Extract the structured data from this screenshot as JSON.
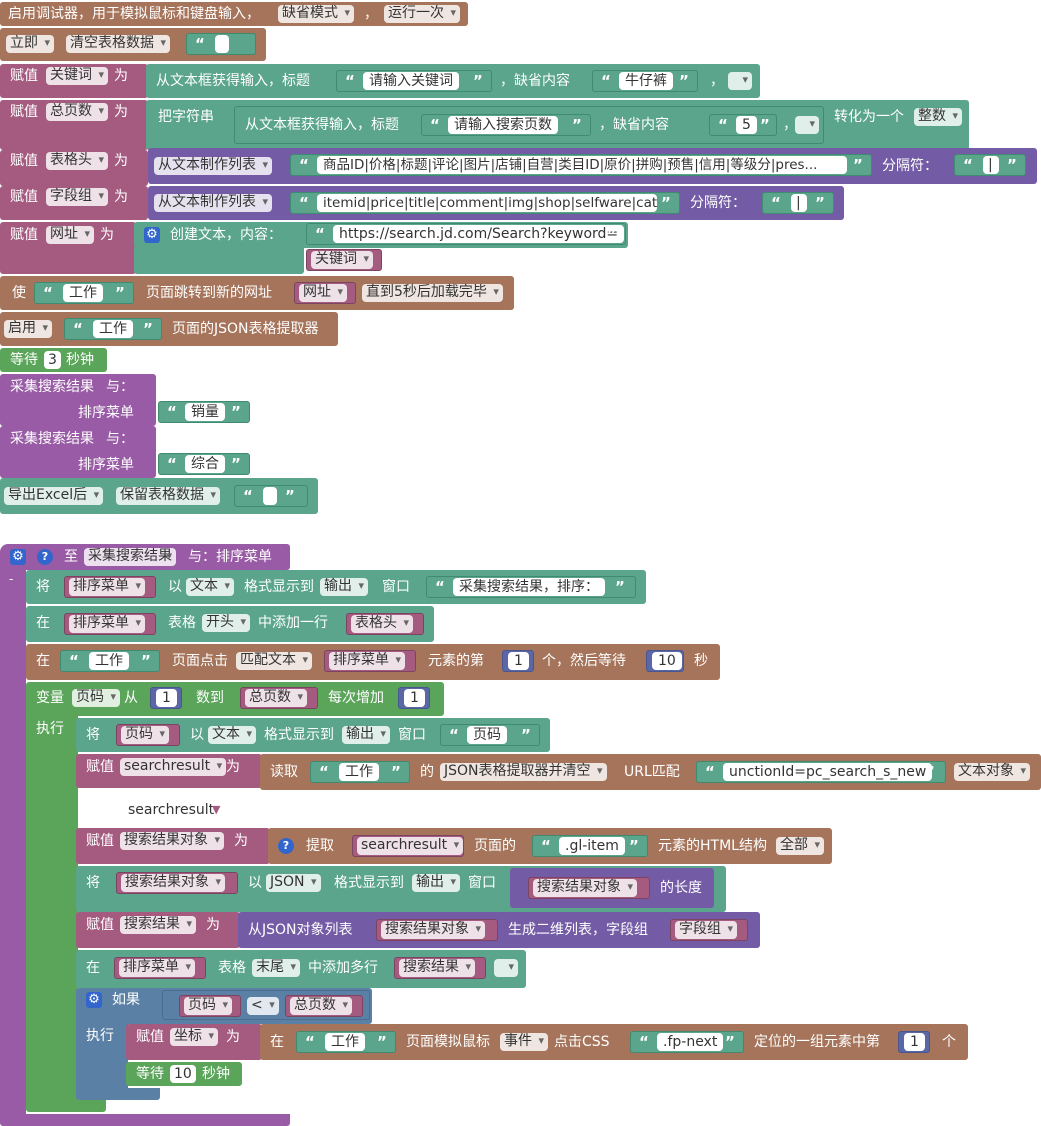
{
  "row1": {
    "text": "启用调试器，用于模拟鼠标和键盘输入，",
    "dd1": "缺省模式",
    "sep": "，",
    "dd2": "运行一次"
  },
  "row2": {
    "dd1": "立即",
    "dd2": "清空表格数据"
  },
  "row3": {
    "assign": "赋值",
    "var": "关键词",
    "as": "为",
    "text": "从文本框获得输入，标题",
    "title": "请输入关键词",
    "default_label": "，缺省内容",
    "default": "牛仔裤",
    "sep": "，"
  },
  "row4": {
    "assign": "赋值",
    "var": "总页数",
    "as": "为",
    "prefix": "把字符串",
    "text": "从文本框获得输入，标题",
    "title": "请输入搜索页数",
    "default_label": "，缺省内容",
    "default": "5",
    "sep": "，",
    "convert": "转化为一个",
    "type": "整数"
  },
  "row5": {
    "assign": "赋值",
    "var": "表格头",
    "as": "为",
    "fn": "从文本制作列表",
    "value": "商品ID|价格|标题|评论|图片|店铺|自营|类目ID|原价|拼购|预售|信用|等级分|pres...",
    "sep_label": "分隔符：",
    "sep": "|"
  },
  "row6": {
    "assign": "赋值",
    "var": "字段组",
    "as": "为",
    "fn": "从文本制作列表",
    "value": "itemid|price|title|comment|img|shop|selfware|cat...",
    "sep_label": "分隔符：",
    "sep": "|"
  },
  "row7": {
    "assign": "赋值",
    "var": "网址",
    "as": "为",
    "text": "创建文本，内容：",
    "url": "https://search.jd.com/Search?keyword=",
    "var2": "关键词"
  },
  "row8": {
    "use": "使",
    "tab": "工作",
    "text": "页面跳转到新的网址",
    "var": "网址",
    "wait": "直到5秒后加载完毕"
  },
  "row9": {
    "dd": "启用",
    "tab": "工作",
    "text": "页面的JSON表格提取器"
  },
  "row10": {
    "wait": "等待",
    "num": "3",
    "unit": "秒钟"
  },
  "call1": {
    "name": "采集搜索结果",
    "with": "与：",
    "param": "排序菜单",
    "value": "销量"
  },
  "call2": {
    "name": "采集搜索结果",
    "with": "与：",
    "param": "排序菜单",
    "value": "综合"
  },
  "row13": {
    "dd1": "导出Excel后",
    "dd2": "保留表格数据"
  },
  "fn": {
    "to": "至",
    "name": "采集搜索结果",
    "with": "与：排序菜单",
    "collapse": "-",
    "l1": {
      "do": "将",
      "var": "排序菜单",
      "as": "以",
      "fmt": "文本",
      "fmt_label": "格式显示到",
      "out": "输出",
      "win": "窗口",
      "text": "采集搜索结果，排序："
    },
    "l2": {
      "in": "在",
      "var": "排序菜单",
      "tbl": "表格",
      "pos": "开头",
      "add": "中添加一行",
      "var2": "表格头"
    },
    "l3": {
      "in": "在",
      "tab": "工作",
      "click": "页面点击",
      "mode": "匹配文本",
      "var": "排序菜单",
      "nth": "元素的第",
      "n": "1",
      "then": "个，然后等待",
      "secs": "10",
      "unit": "秒"
    },
    "loop": {
      "var_label": "变量",
      "var": "页码",
      "from": "从",
      "start": "1",
      "to": "数到",
      "end_var": "总页数",
      "step_label": "每次增加",
      "step": "1",
      "do": "执行"
    },
    "l4": {
      "do": "将",
      "var": "页码",
      "as": "以",
      "fmt": "文本",
      "fmt_label": "格式显示到",
      "out": "输出",
      "win": "窗口",
      "text": "页码"
    },
    "l5": {
      "assign": "赋值",
      "var": "searchresult",
      "as": "为",
      "read": "读取",
      "tab": "工作",
      "of": "的",
      "extractor": "JSON表格提取器并清空",
      "url": "URL匹配",
      "match": "unctionId=pc_search_s_new",
      "obj": "文本对象",
      "hint": "searchresult"
    },
    "l6": {
      "assign": "赋值",
      "var": "搜索结果对象",
      "as": "为",
      "extract": "提取",
      "var2": "searchresult",
      "page": "页面的",
      "sel": ".gl-item",
      "html": "元素的HTML结构",
      "all": "全部"
    },
    "l7": {
      "do": "将",
      "var": "搜索结果对象",
      "as": "以",
      "fmt": "JSON",
      "fmt_label": "格式显示到",
      "out": "输出",
      "win": "窗口",
      "var2": "搜索结果对象",
      "len": "的长度"
    },
    "l8": {
      "assign": "赋值",
      "var": "搜索结果",
      "as": "为",
      "fn": "从JSON对象列表",
      "var2": "搜索结果对象",
      "gen": "生成二维列表，字段组",
      "var3": "字段组"
    },
    "l9": {
      "in": "在",
      "var": "排序菜单",
      "tbl": "表格",
      "pos": "末尾",
      "add": "中添加多行",
      "var2": "搜索结果"
    },
    "if": {
      "if": "如果",
      "a": "页码",
      "op": "<",
      "b": "总页数",
      "do": "执行"
    },
    "l10": {
      "assign": "赋值",
      "var": "坐标",
      "as": "为",
      "in": "在",
      "tab": "工作",
      "mouse": "页面模拟鼠标",
      "evt": "事件",
      "click": "点击CSS",
      "sel": ".fp-next",
      "locate": "定位的一组元素中第",
      "n": "1",
      "unit": "个"
    },
    "l11": {
      "wait": "等待",
      "num": "10",
      "unit": "秒钟"
    }
  }
}
